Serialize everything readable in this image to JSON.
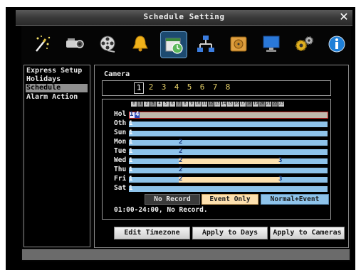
{
  "window": {
    "title": "Schedule Setting",
    "close_label": "✕"
  },
  "toolbar": {
    "icons": [
      "magic-wand-icon",
      "camera-icon",
      "film-reel-icon",
      "bell-icon",
      "schedule-clock-icon",
      "network-icon",
      "hard-drive-icon",
      "monitor-icon",
      "gears-icon",
      "info-icon"
    ],
    "selected": "schedule-clock-icon"
  },
  "sidebar": {
    "items": [
      {
        "label": "Express Setup"
      },
      {
        "label": "Holidays"
      },
      {
        "label": "Schedule",
        "selected": true
      },
      {
        "label": "Alarm Action"
      }
    ]
  },
  "camera": {
    "label": "Camera",
    "options": [
      "1",
      "2",
      "3",
      "4",
      "5",
      "6",
      "7",
      "8"
    ],
    "selected": "1"
  },
  "hours": [
    "0",
    "1",
    "2",
    "3",
    "4",
    "5",
    "6",
    "7",
    "8",
    "9",
    "10",
    "11",
    "12",
    "13",
    "14",
    "15",
    "16",
    "17",
    "18",
    "19",
    "20",
    "21",
    "22",
    "23"
  ],
  "days": [
    {
      "label": "Hol",
      "markers": [
        "1",
        "4"
      ]
    },
    {
      "label": "Oth",
      "markers": [
        "1"
      ]
    },
    {
      "label": "Sun",
      "markers": [
        "1"
      ]
    },
    {
      "label": "Mon",
      "markers": [
        "1",
        "2"
      ]
    },
    {
      "label": "Tue",
      "markers": [
        "1",
        "2"
      ]
    },
    {
      "label": "Wed",
      "markers": [
        "1",
        "2",
        "3"
      ]
    },
    {
      "label": "Thu",
      "markers": [
        "1",
        "2"
      ]
    },
    {
      "label": "Fri",
      "markers": [
        "1",
        "2",
        "3"
      ]
    },
    {
      "label": "Sat",
      "markers": [
        "1"
      ]
    }
  ],
  "legend": {
    "no_record": "No Record",
    "event_only": "Event Only",
    "normal_event": "Normal+Event",
    "colors": {
      "no_record": "#333333",
      "event_only": "#fde0ae",
      "normal_event": "#8ec3ea"
    }
  },
  "note": "01:00-24:00, No Record.",
  "buttons": {
    "edit_timezone": "Edit Timezone",
    "apply_days": "Apply to Days",
    "apply_cameras": "Apply to Cameras"
  }
}
